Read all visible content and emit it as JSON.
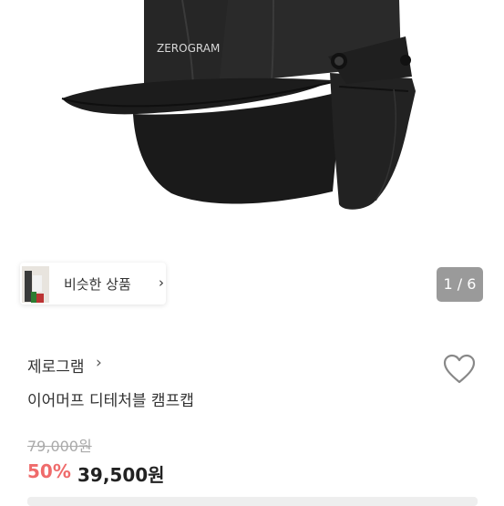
{
  "product_image": {
    "logo_text": "ZEROGRAM"
  },
  "similar_button": {
    "label": "비슷한 상품",
    "chevron": "›"
  },
  "image_counter": "1 / 6",
  "brand": {
    "name": "제로그램",
    "chevron": "›"
  },
  "product": {
    "name": "이어머프 디테처블 캠프캡",
    "original_price": "79,000원",
    "discount": "50%",
    "price": "39,500원"
  },
  "icons": {
    "wishlist": "heart-outline-icon",
    "similar_chevron": "chevron-right-icon"
  },
  "colors": {
    "discount": "#ef6b6b",
    "counter_bg": "#9a9a9a"
  }
}
